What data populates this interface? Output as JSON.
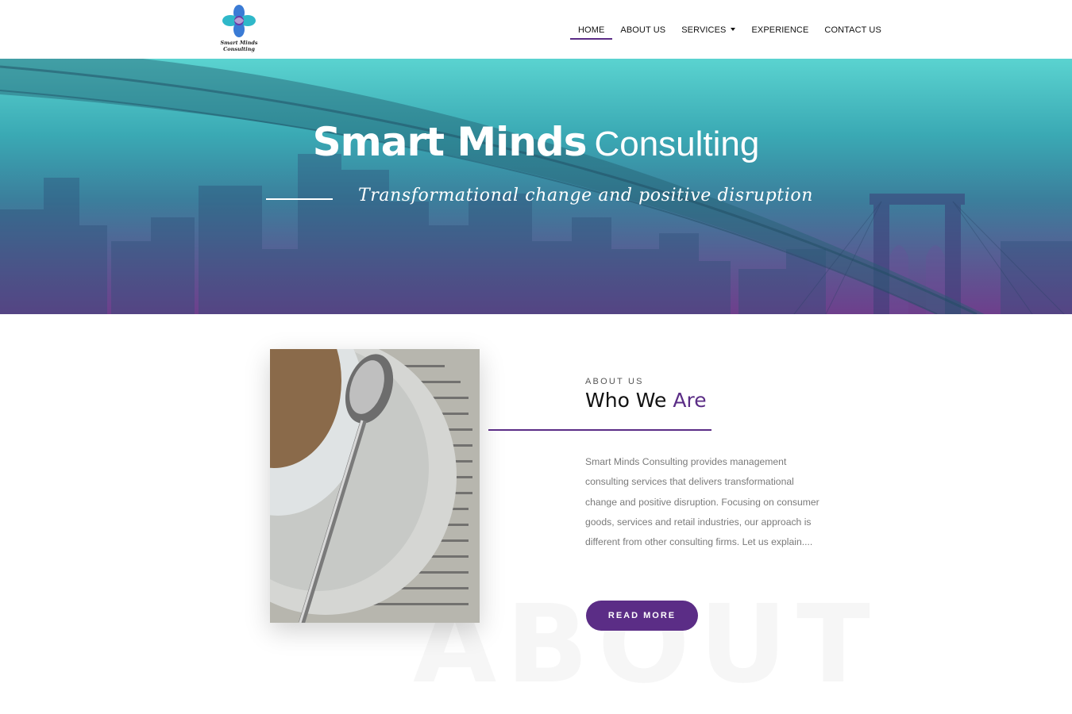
{
  "brand": {
    "logo_text": "Smart Minds Consulting",
    "accent_color": "#5b2d86",
    "logo_colors": [
      "#2fb8c9",
      "#3a7bd5",
      "#6a3aa6"
    ]
  },
  "nav": {
    "items": [
      {
        "label": "HOME",
        "active": true
      },
      {
        "label": "ABOUT US",
        "active": false
      },
      {
        "label": "SERVICES",
        "active": false,
        "has_dropdown": true
      },
      {
        "label": "EXPERIENCE",
        "active": false
      },
      {
        "label": "CONTACT US",
        "active": false
      }
    ]
  },
  "hero": {
    "title_bold": "Smart Minds",
    "title_light": "Consulting",
    "subtitle": "Transformational change and positive disruption",
    "gradient": [
      "#5ad3d0",
      "#6e3f8c"
    ]
  },
  "about": {
    "eyebrow": "ABOUT US",
    "heading_main": "Who We",
    "heading_accent": "Are",
    "paragraph": "Smart Minds Consulting provides management consulting services that delivers transformational change and positive disruption. Focusing on consumer goods, services and retail industries, our approach is different from other consulting firms. Let us explain....",
    "button_label": "READ MORE",
    "watermark": "ABOUT"
  }
}
